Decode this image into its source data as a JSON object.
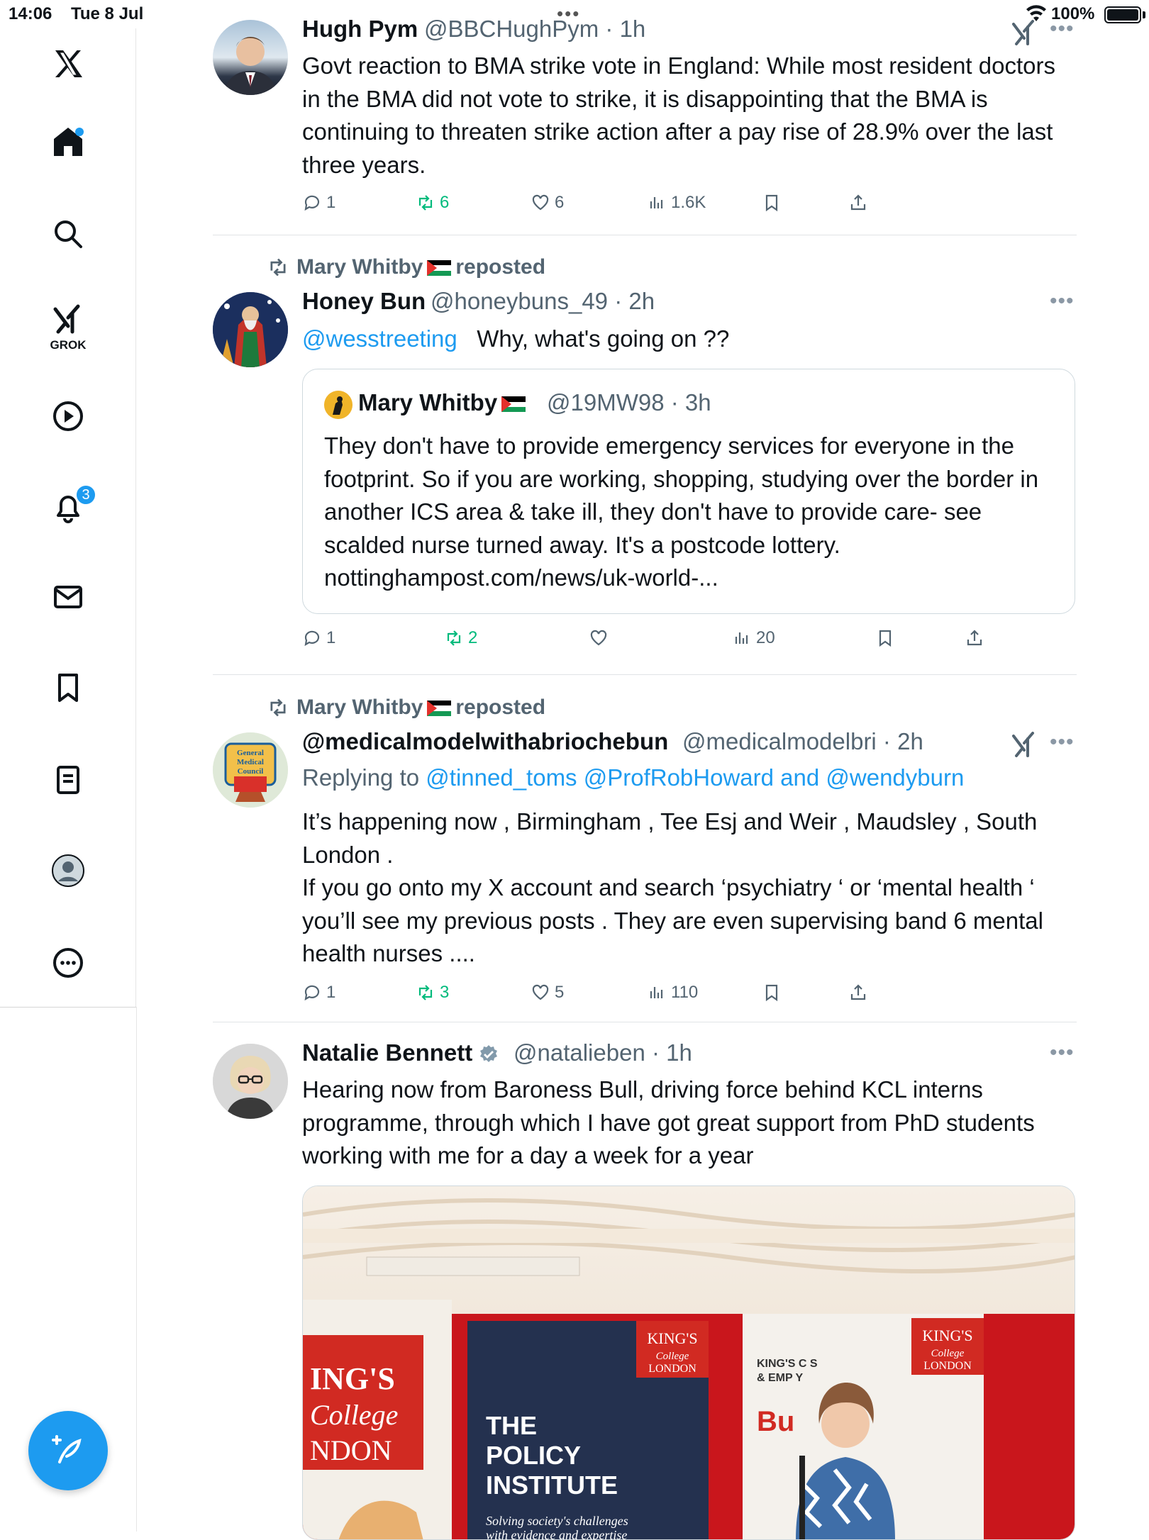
{
  "status_bar": {
    "time": "14:06",
    "date": "Tue 8 Jul",
    "battery": "100%"
  },
  "sidebar": {
    "grok_label": "GROK",
    "notifications_count": "3",
    "items": [
      "x-logo",
      "home",
      "search",
      "grok",
      "video",
      "notifications",
      "messages",
      "bookmarks",
      "lists",
      "profile",
      "more"
    ]
  },
  "tweets": [
    {
      "name": "Hugh Pym",
      "handle": "@BBCHughPym",
      "time": "1h",
      "body": "Govt reaction to BMA strike vote in England: While most resident doctors in the BMA did not vote to strike, it is disappointing that the BMA is continuing to threaten strike action after a pay rise of 28.9% over the last three years.",
      "replies": "1",
      "reposts": "6",
      "likes": "6",
      "views": "1.6K"
    },
    {
      "reposted_by": "Mary Whitby",
      "reposted_word": "reposted",
      "name": "Honey Bun",
      "handle": "@honeybuns_49",
      "time": "2h",
      "mention": "@wesstreeting",
      "body": "Why, what's going on ??",
      "quote": {
        "name": "Mary Whitby",
        "handle": "@19MW98",
        "time": "3h",
        "body": "They don't have to provide emergency services for everyone in the footprint. So if you are working, shopping, studying over the border in another ICS area & take ill, they don't have to provide care- see scalded nurse turned away. It's a postcode lottery. nottinghampost.com/news/uk-world-..."
      },
      "replies": "1",
      "reposts": "2",
      "likes": "",
      "views": "20"
    },
    {
      "reposted_by": "Mary Whitby",
      "reposted_word": "reposted",
      "name": "@medicalmodelwithabriochebun",
      "handle": "@medicalmodelbri",
      "time": "2h",
      "replying_prefix": "Replying to",
      "replying_to": "@tinned_toms @ProfRobHoward and @wendyburn",
      "body_line1": "It’s happening now , Birmingham , Tee Esj and Weir , Maudsley , South London .",
      "body_line2": "If you go onto my X account and search ‘psychiatry ‘ or ‘mental health ‘ you’ll see my previous posts . They are even supervising band 6 mental health nurses ....",
      "avatar_text": "General Medical Council",
      "replies": "1",
      "reposts": "3",
      "likes": "5",
      "views": "110"
    },
    {
      "name": "Natalie Bennett",
      "handle": "@natalieben",
      "time": "1h",
      "body": "Hearing now from Baroness Bull, driving force behind KCL interns programme, through which I have got great support from PhD students working with me for a day a week for a year",
      "media": {
        "banner_left": "ING'S College NDON",
        "banner_mid_title": "THE POLICY INSTITUTE",
        "banner_mid_sub": "Solving society's challenges with evidence and expertise",
        "logo_text": "KING'S College LONDON",
        "banner_right_small": "KING'S C  S & EMP   Y"
      }
    }
  ],
  "colors": {
    "accent": "#1d9bf0",
    "repost_green": "#00ba7c",
    "muted": "#536471"
  }
}
